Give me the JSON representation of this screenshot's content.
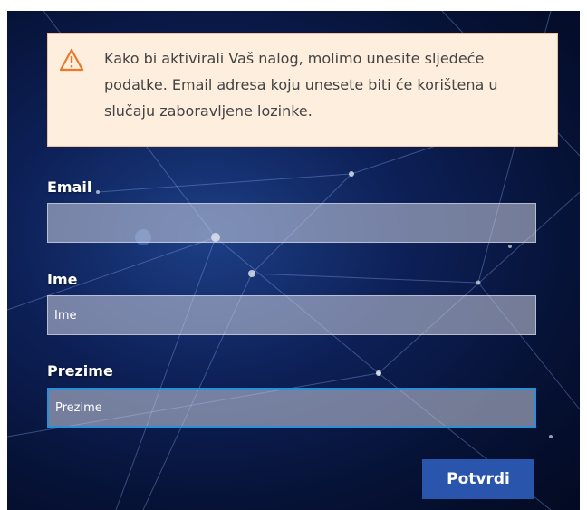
{
  "alert": {
    "icon": "warning-icon",
    "message": "Kako bi aktivirali Vaš nalog, molimo unesite sljedeće podatke. Email adresa koju unesete biti će korištena u slučaju zaboravljene lozinke."
  },
  "form": {
    "email": {
      "label": "Email",
      "value": "",
      "placeholder": ""
    },
    "first_name": {
      "label": "Ime",
      "value": "",
      "placeholder": "Ime"
    },
    "last_name": {
      "label": "Prezime",
      "value": "",
      "placeholder": "Prezime"
    },
    "submit_label": "Potvrdi"
  },
  "colors": {
    "alert_background": "#fdeedd",
    "alert_icon": "#e8792a",
    "button": "#2a55ad",
    "focus_border": "#2a8fd6"
  }
}
